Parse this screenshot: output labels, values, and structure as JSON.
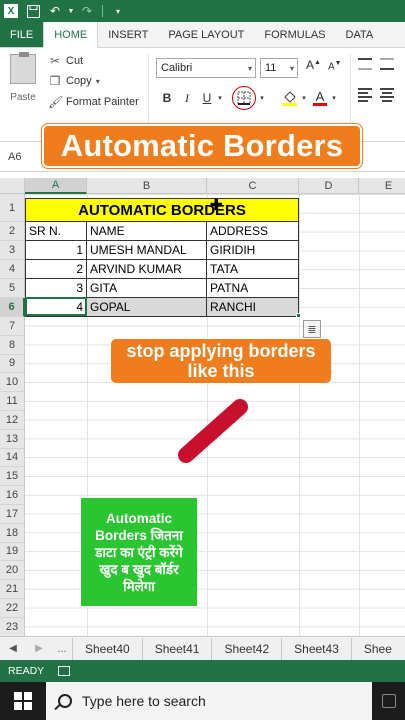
{
  "ribbon_tabs": [
    "FILE",
    "HOME",
    "INSERT",
    "PAGE LAYOUT",
    "FORMULAS",
    "DATA"
  ],
  "clipboard": {
    "paste": "Paste",
    "cut": "Cut",
    "copy": "Copy",
    "format_painter": "Format Painter"
  },
  "font": {
    "name": "Calibri",
    "size": "11",
    "bold": "B",
    "italic": "I",
    "underline": "U",
    "grow": "A",
    "shrink": "A"
  },
  "name_box": "A6",
  "banner_title": "Automatic Borders",
  "columns": [
    "A",
    "B",
    "C",
    "D",
    "E"
  ],
  "rows": [
    "1",
    "2",
    "3",
    "4",
    "5",
    "6",
    "7",
    "8",
    "9",
    "10",
    "11",
    "12",
    "13",
    "14",
    "15",
    "16",
    "17",
    "18",
    "19",
    "20",
    "21",
    "22",
    "23"
  ],
  "sheet": {
    "title": "AUTOMATIC BORDERS",
    "headers": [
      "SR N.",
      "NAME",
      "ADDRESS"
    ],
    "data": [
      [
        "1",
        "UMESH MANDAL",
        "GIRIDIH"
      ],
      [
        "2",
        "ARVIND KUMAR",
        "TATA"
      ],
      [
        "3",
        "GITA",
        "PATNA"
      ],
      [
        "4",
        "GOPAL",
        "RANCHI"
      ]
    ]
  },
  "note_orange": {
    "line1": "stop applying borders",
    "line2": "like this"
  },
  "note_green": {
    "line1": "Automatic",
    "line2": "Borders जितना",
    "line3": "डाटा का एंट्री करेंगे",
    "line4": "खुद ब खुद बॉर्डर",
    "line5": "मिलेगा"
  },
  "sheet_tabs": [
    "...",
    "Sheet40",
    "Sheet41",
    "Sheet42",
    "Sheet43",
    "Shee"
  ],
  "status": "READY",
  "taskbar": {
    "search_placeholder": "Type here to search"
  },
  "colors": {
    "excel_green": "#217346",
    "banner_orange": "#f07d1d",
    "note_green": "#2bc531",
    "title_yellow": "#ffff00",
    "slash_red": "#c8102e"
  }
}
